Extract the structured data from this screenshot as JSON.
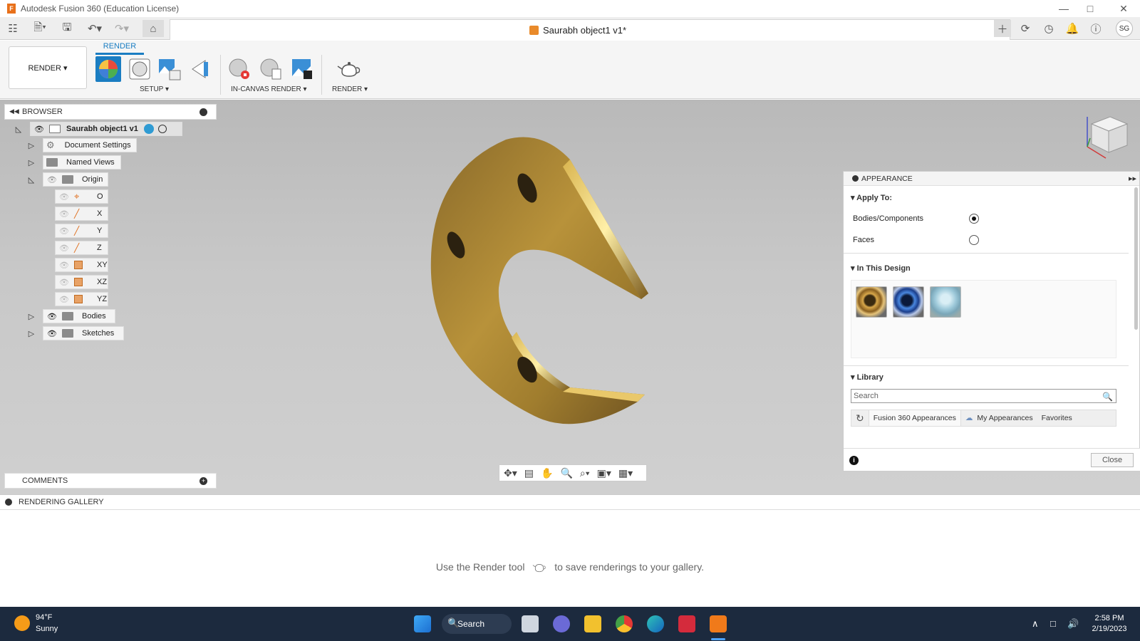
{
  "window": {
    "title": "Autodesk Fusion 360 (Education License)"
  },
  "document": {
    "tab_title": "Saurabh object1 v1*"
  },
  "user": {
    "initials": "SG"
  },
  "ribbon": {
    "workspace": "RENDER ▾",
    "active_tab": "RENDER",
    "groups": {
      "setup": "SETUP ▾",
      "in_canvas_render": "IN-CANVAS RENDER ▾",
      "render": "RENDER ▾"
    }
  },
  "browser": {
    "title": "BROWSER",
    "root": "Saurabh object1 v1",
    "nodes": {
      "document_settings": "Document Settings",
      "named_views": "Named Views",
      "origin": "Origin",
      "bodies": "Bodies",
      "sketches": "Sketches"
    },
    "origin_children": [
      "O",
      "X",
      "Y",
      "Z",
      "XY",
      "XZ",
      "YZ"
    ]
  },
  "comments": {
    "title": "COMMENTS"
  },
  "appearance": {
    "title": "APPEARANCE",
    "apply_to": {
      "title": "Apply To:",
      "bodies_components": "Bodies/Components",
      "faces": "Faces",
      "selected": "Bodies/Components"
    },
    "in_this_design": {
      "title": "In This Design"
    },
    "library": {
      "title": "Library",
      "search_placeholder": "Search",
      "tabs": {
        "fusion": "Fusion 360 Appearances",
        "my": "My Appearances",
        "favorites": "Favorites"
      }
    },
    "close": "Close"
  },
  "gallery": {
    "title": "RENDERING GALLERY",
    "message_before": "Use the Render tool",
    "message_after": "to save renderings to your gallery."
  },
  "taskbar": {
    "weather_temp": "94°F",
    "weather_cond": "Sunny",
    "search_label": "Search",
    "time": "2:58 PM",
    "date": "2/19/2023"
  },
  "colors": {
    "accent": "#1a7dc2",
    "brass": "#b8923a",
    "taskbar": "#1c2a3e"
  }
}
